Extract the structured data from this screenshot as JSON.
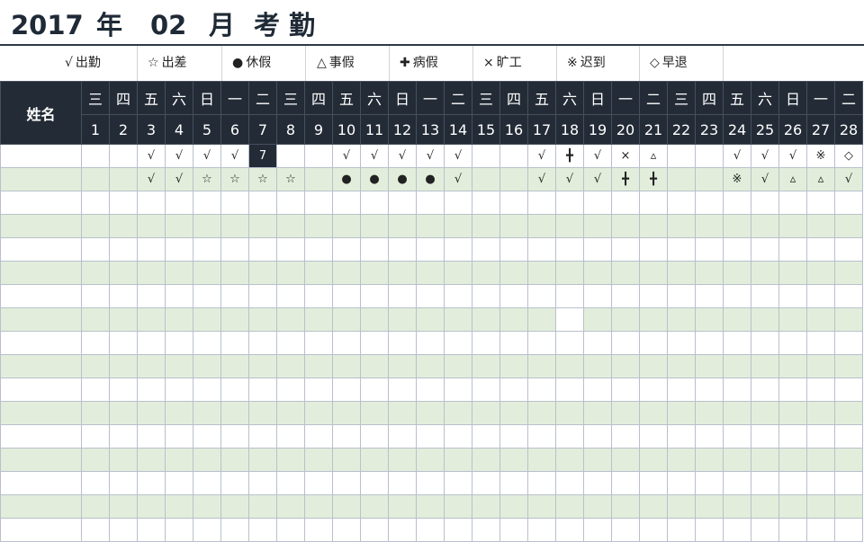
{
  "title": {
    "year": "2017",
    "year_unit": "年",
    "month": "02",
    "month_unit": "月",
    "label": "考 勤"
  },
  "legend": [
    {
      "symbol": "√",
      "label": "出勤",
      "icon": "check-icon"
    },
    {
      "symbol": "☆",
      "label": "出差",
      "icon": "star-icon"
    },
    {
      "symbol": "●",
      "label": "休假",
      "icon": "dot-icon"
    },
    {
      "symbol": "△",
      "label": "事假",
      "icon": "triangle-icon"
    },
    {
      "symbol": "✚",
      "label": "病假",
      "icon": "cross-icon"
    },
    {
      "symbol": "×",
      "label": "旷工",
      "icon": "x-icon"
    },
    {
      "symbol": "※",
      "label": "迟到",
      "icon": "reference-mark-icon"
    },
    {
      "symbol": "◇",
      "label": "早退",
      "icon": "diamond-icon"
    }
  ],
  "header": {
    "name_label": "姓名",
    "weekdays": [
      "三",
      "四",
      "五",
      "六",
      "日",
      "一",
      "二",
      "三",
      "四",
      "五",
      "六",
      "日",
      "一",
      "二",
      "三",
      "四",
      "五",
      "六",
      "日",
      "一",
      "二",
      "三",
      "四",
      "五",
      "六",
      "日",
      "一",
      "二"
    ],
    "days": [
      "1",
      "2",
      "3",
      "4",
      "5",
      "6",
      "7",
      "8",
      "9",
      "10",
      "11",
      "12",
      "13",
      "14",
      "15",
      "16",
      "17",
      "18",
      "19",
      "20",
      "21",
      "22",
      "23",
      "24",
      "25",
      "26",
      "27",
      "28"
    ]
  },
  "rows": [
    {
      "name": "",
      "marks": [
        "",
        "",
        "√",
        "√",
        "√",
        "√",
        "7",
        "",
        "",
        "√",
        "√",
        "√",
        "√",
        "√",
        "",
        "",
        "√",
        "╋",
        "√",
        "×",
        "▵",
        "",
        "",
        "√",
        "√",
        "√",
        "※",
        "◇"
      ]
    },
    {
      "name": "",
      "marks": [
        "",
        "",
        "√",
        "√",
        "☆",
        "☆",
        "☆",
        "☆",
        "",
        "●",
        "●",
        "●",
        "●",
        "√",
        "",
        "",
        "√",
        "√",
        "√",
        "╋",
        "╋",
        "",
        "",
        "※",
        "√",
        "▵",
        "▵",
        "√"
      ]
    },
    {
      "name": "",
      "marks": []
    },
    {
      "name": "",
      "marks": []
    },
    {
      "name": "",
      "marks": []
    },
    {
      "name": "",
      "marks": []
    },
    {
      "name": "",
      "marks": []
    },
    {
      "name": "",
      "marks": []
    },
    {
      "name": "",
      "marks": []
    },
    {
      "name": "",
      "marks": []
    },
    {
      "name": "",
      "marks": []
    },
    {
      "name": "",
      "marks": []
    },
    {
      "name": "",
      "marks": []
    },
    {
      "name": "",
      "marks": []
    },
    {
      "name": "",
      "marks": []
    },
    {
      "name": "",
      "marks": []
    },
    {
      "name": "",
      "marks": []
    }
  ],
  "selected_cell": {
    "row": 0,
    "col": 6
  },
  "colors": {
    "header_bg": "#232b36",
    "band_green": "#e2eedb",
    "grid_line": "#b9c0cc",
    "title_text": "#1f2a36"
  }
}
